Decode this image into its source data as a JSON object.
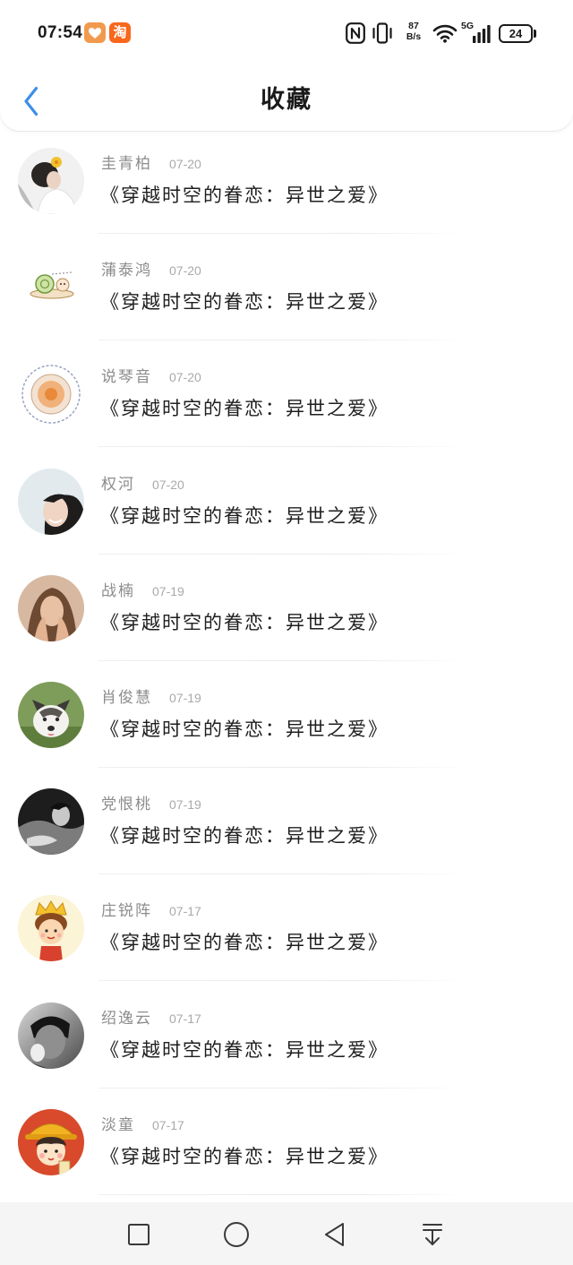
{
  "status_bar": {
    "time": "07:54",
    "notification_icons": [
      "orange-heart-app-icon",
      "taobao-app-icon"
    ],
    "taobao_label": "淘",
    "system_icons": [
      "nfc-icon",
      "vibrate-icon",
      "wifi-icon",
      "cellular-signal-icon",
      "battery-icon"
    ],
    "net_speed_value": "87",
    "net_speed_unit": "B/s",
    "network_type": "5G",
    "battery_level": "24"
  },
  "header": {
    "back_icon": "chevron-left-icon",
    "title": "收藏"
  },
  "favorites": [
    {
      "name": "圭青柏",
      "date": "07-20",
      "title": "《穿越时空的眷恋：异世之爱》"
    },
    {
      "name": "蒲泰鸿",
      "date": "07-20",
      "title": "《穿越时空的眷恋：异世之爱》"
    },
    {
      "name": "说琴音",
      "date": "07-20",
      "title": "《穿越时空的眷恋：异世之爱》"
    },
    {
      "name": "权河",
      "date": "07-20",
      "title": "《穿越时空的眷恋：异世之爱》"
    },
    {
      "name": "战楠",
      "date": "07-19",
      "title": "《穿越时空的眷恋：异世之爱》"
    },
    {
      "name": "肖俊慧",
      "date": "07-19",
      "title": "《穿越时空的眷恋：异世之爱》"
    },
    {
      "name": "党恨桃",
      "date": "07-19",
      "title": "《穿越时空的眷恋：异世之爱》"
    },
    {
      "name": "庄锐阵",
      "date": "07-17",
      "title": "《穿越时空的眷恋：异世之爱》"
    },
    {
      "name": "绍逸云",
      "date": "07-17",
      "title": "《穿越时空的眷恋：异世之爱》"
    },
    {
      "name": "淡童",
      "date": "07-17",
      "title": "《穿越时空的眷恋：异世之爱》"
    }
  ],
  "system_nav": {
    "icons": [
      "recent-apps-square-icon",
      "home-circle-icon",
      "back-triangle-icon",
      "pull-down-icon"
    ]
  },
  "colors": {
    "accent": "#3d8fe8",
    "title_text": "#1e1e1e",
    "meta_text": "#8c8c8c",
    "taobao_orange": "#f7671c"
  }
}
